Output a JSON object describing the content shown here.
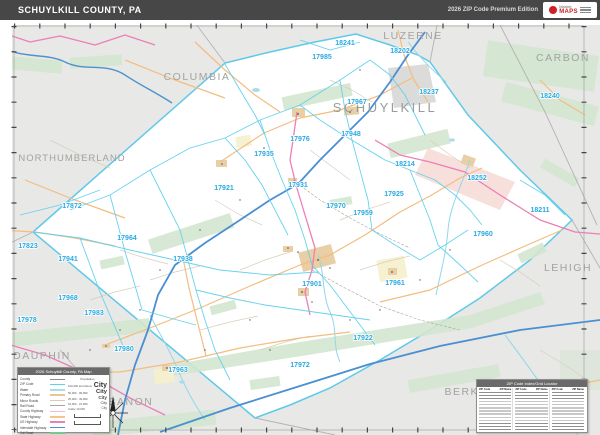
{
  "header": {
    "title": "SCHUYLKILL COUNTY, PA",
    "edition": "2026 ZIP Code Premium Edition",
    "logo_line1": "Market",
    "logo_line2": "MAPS"
  },
  "map": {
    "schuylkill_label": "SCHUYLKILL",
    "county_labels": {
      "columbia": "COLUMBIA",
      "luzerne": "LUZERNE",
      "carbon": "CARBON",
      "northumberland": "NORTHUMBERLAND",
      "lehigh": "LEHIGH",
      "dauphin": "DAUPHIN",
      "lebanon": "LEBANON",
      "berks": "BERKS"
    },
    "zip_labels": [
      "17872",
      "17823",
      "17964",
      "17941",
      "17968",
      "17983",
      "17978",
      "17980",
      "17938",
      "17963",
      "17921",
      "17935",
      "17931",
      "17976",
      "17948",
      "17967",
      "17985",
      "18241",
      "18202",
      "18237",
      "18240",
      "17970",
      "17959",
      "17925",
      "18214",
      "18252",
      "18211",
      "17960",
      "17961",
      "17901",
      "17922",
      "17972"
    ],
    "colors": {
      "zip_label": "#29a9e1",
      "zip_boundary": "#5fd0ee",
      "county_fill": "#ffffff",
      "outside_fill": "#e8e8e6",
      "interstate": "#4a8fd2",
      "us_highway": "#ec7fb4",
      "state_highway": "#f5c488",
      "forest": "#d3e6d0",
      "urban": "#e9cfa6",
      "urban_pink": "#f6d9d5"
    }
  },
  "legend": {
    "title": "2026 Schuylkill County, PA Map",
    "items": [
      {
        "label": "County",
        "css": "background:#8c8c8c;height:1px"
      },
      {
        "label": "ZIP Code",
        "css": "background:#5fd0ee;height:1.6px"
      },
      {
        "label": "Water",
        "css": "background:#a9dcee;height:2.4px"
      },
      {
        "label": "Primary Road",
        "css": "background:#f0c28e;height:1.4px"
      },
      {
        "label": "Minor Roads",
        "css": "background:#d8ccb8;height:1px"
      },
      {
        "label": "Rail Road",
        "css": "background:#a9a49c;height:1px"
      },
      {
        "label": "County Highway",
        "css": "background:#f6b9d0;height:1.6px"
      },
      {
        "label": "State Highway",
        "css": "background:#f5c488;height:1.6px"
      },
      {
        "label": "US Highway",
        "css": "background:#ec7fb4;height:1.6px"
      },
      {
        "label": "Interstate Highway",
        "css": "background:#4a8fd2;height:1.8px"
      },
      {
        "label": "Toll Road",
        "css": "background:#74c98e;height:1.8px"
      }
    ],
    "population": {
      "header": "Population",
      "rows": [
        {
          "range": "100,000 and Above",
          "sample": "City"
        },
        {
          "range": "50,000 - 99,999",
          "sample": "City"
        },
        {
          "range": "25,000 - 49,999",
          "sample": "City"
        },
        {
          "range": "10,000 - 24,999",
          "sample": "City"
        },
        {
          "range": "Under 10,000",
          "sample": "City"
        }
      ]
    }
  },
  "zip_index": {
    "title": "ZIP Code Index/Grid Locator",
    "col_zip": "ZIP Code",
    "col_name": "ZIP Name"
  }
}
